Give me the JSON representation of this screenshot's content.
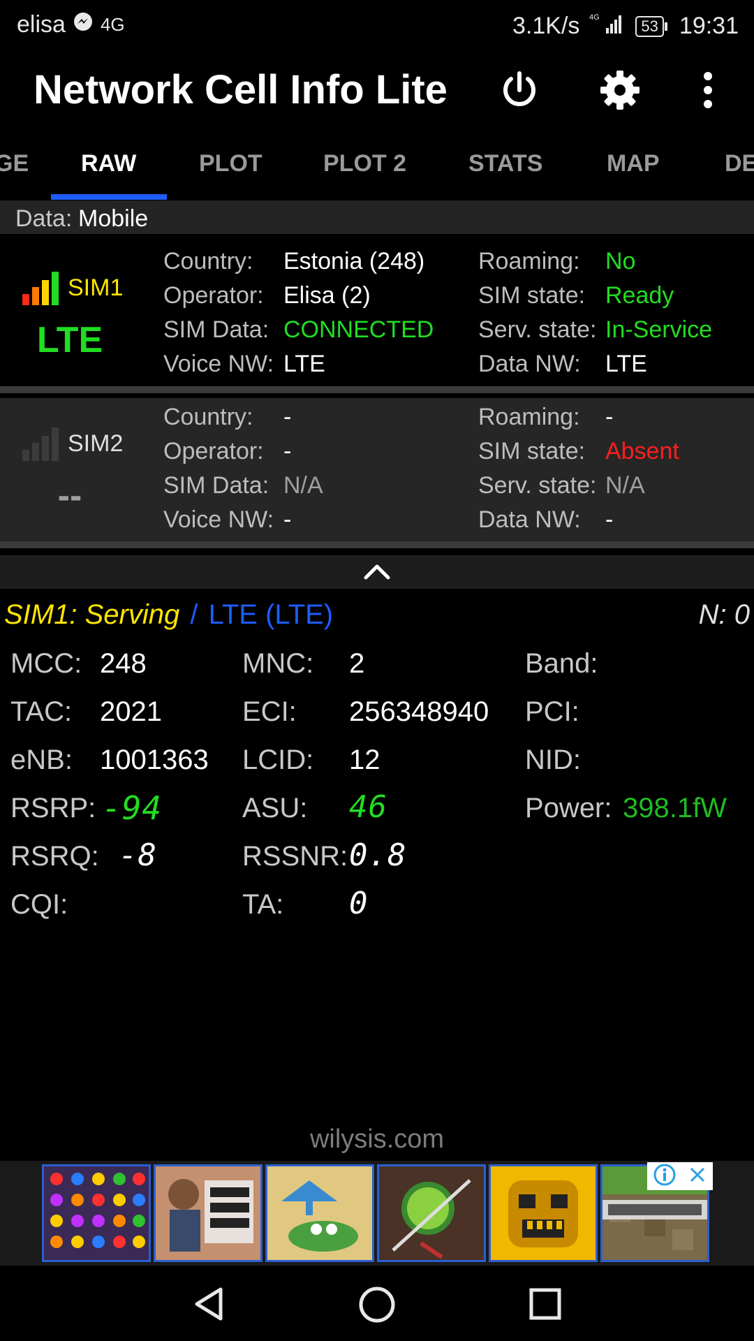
{
  "status_bar": {
    "carrier": "elisa",
    "network_type": "4G",
    "speed": "3.1K/s",
    "signal_label": "4G",
    "battery": "53",
    "time": "19:31"
  },
  "app": {
    "title": "Network Cell Info Lite"
  },
  "tabs": [
    {
      "label": "GE"
    },
    {
      "label": "RAW"
    },
    {
      "label": "PLOT"
    },
    {
      "label": "PLOT 2"
    },
    {
      "label": "STATS"
    },
    {
      "label": "MAP"
    },
    {
      "label": "DE"
    }
  ],
  "active_tab": "RAW",
  "data_row": {
    "label": "Data:",
    "value": "Mobile"
  },
  "sim1": {
    "name": "SIM1",
    "tech": "LTE",
    "left": [
      {
        "key": "Country:",
        "value": "Estonia (248)"
      },
      {
        "key": "Operator:",
        "value": "Elisa (2)"
      },
      {
        "key": "SIM Data:",
        "value": "CONNECTED"
      },
      {
        "key": "Voice NW:",
        "value": "LTE"
      }
    ],
    "right": [
      {
        "key": "Roaming:",
        "value": "No"
      },
      {
        "key": "SIM state:",
        "value": "Ready"
      },
      {
        "key": "Serv. state:",
        "value": "In-Service"
      },
      {
        "key": "Data NW:",
        "value": "LTE"
      }
    ]
  },
  "sim2": {
    "name": "SIM2",
    "tech": "--",
    "left": [
      {
        "key": "Country:",
        "value": "-"
      },
      {
        "key": "Operator:",
        "value": "-"
      },
      {
        "key": "SIM Data:",
        "value": "N/A"
      },
      {
        "key": "Voice NW:",
        "value": "-"
      }
    ],
    "right": [
      {
        "key": "Roaming:",
        "value": "-"
      },
      {
        "key": "SIM state:",
        "value": "Absent"
      },
      {
        "key": "Serv. state:",
        "value": "N/A"
      },
      {
        "key": "Data NW:",
        "value": "-"
      }
    ]
  },
  "serving": {
    "prefix": "SIM1: Serving",
    "slash": "/",
    "tech": "LTE (LTE)",
    "neighbors": "N: 0"
  },
  "cell": {
    "col1": [
      {
        "key": "MCC:",
        "value": "248"
      },
      {
        "key": "TAC:",
        "value": "2021"
      },
      {
        "key": "eNB:",
        "value": "1001363"
      },
      {
        "key": "RSRP:",
        "value": "-94"
      },
      {
        "key": "RSRQ:",
        "value": "-8"
      },
      {
        "key": "CQI:",
        "value": ""
      }
    ],
    "col2": [
      {
        "key": "MNC:",
        "value": "2"
      },
      {
        "key": "ECI:",
        "value": "256348940"
      },
      {
        "key": "LCID:",
        "value": "12"
      },
      {
        "key": "ASU:",
        "value": "46"
      },
      {
        "key": "RSSNR:",
        "value": "0.8"
      },
      {
        "key": "TA:",
        "value": "0"
      }
    ],
    "col3": [
      {
        "key": "Band:",
        "value": ""
      },
      {
        "key": "PCI:",
        "value": ""
      },
      {
        "key": "NID:",
        "value": ""
      },
      {
        "key": "Power:",
        "value": "398.1fW"
      }
    ]
  },
  "watermark": "wilysis.com",
  "colors": {
    "accent_blue": "#1e5cff",
    "green": "#22dd22",
    "red": "#ff1e1e",
    "yellow": "#ffe600"
  }
}
